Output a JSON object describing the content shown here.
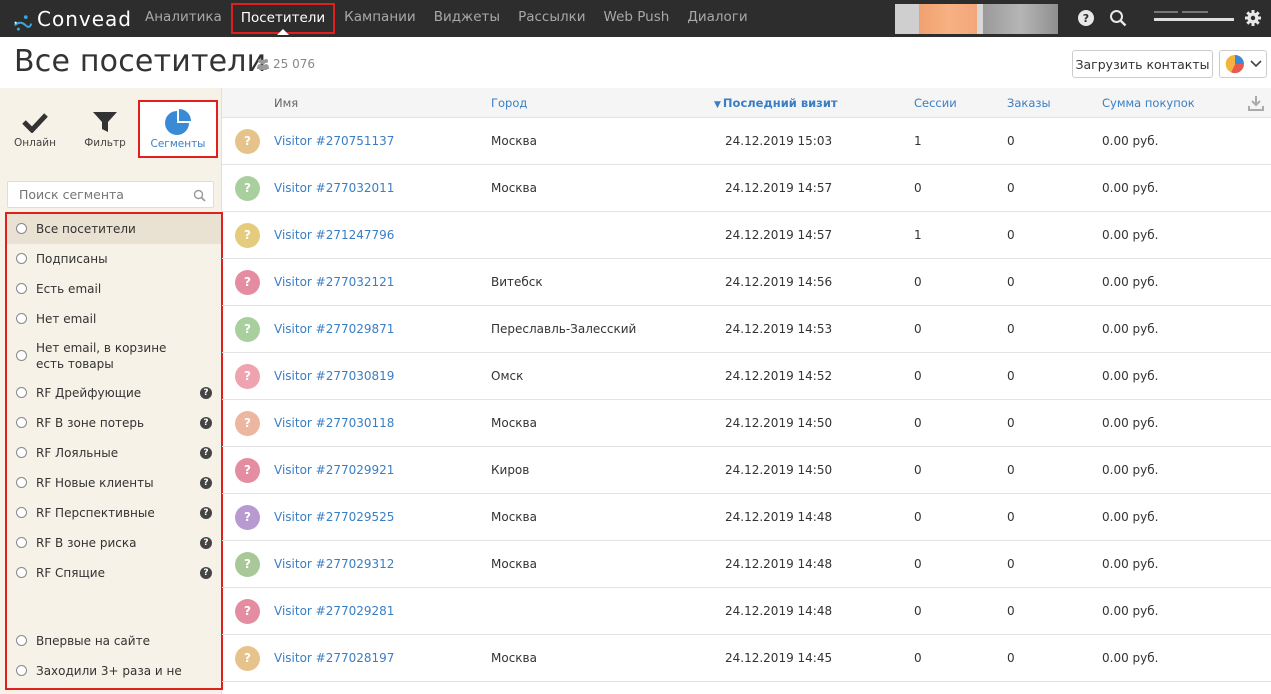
{
  "app": {
    "logo_text": "Convead",
    "nav": [
      {
        "label": "Аналитика",
        "active": false
      },
      {
        "label": "Посетители",
        "active": true
      },
      {
        "label": "Кампании",
        "active": false
      },
      {
        "label": "Виджеты",
        "active": false
      },
      {
        "label": "Рассылки",
        "active": false
      },
      {
        "label": "Web Push",
        "active": false
      },
      {
        "label": "Диалоги",
        "active": false
      }
    ],
    "icons": [
      "help-icon",
      "search-icon",
      "gear-icon"
    ]
  },
  "page": {
    "title": "Все посетители",
    "count": "25 076",
    "upload_button": "Загрузить контакты"
  },
  "sidebar": {
    "modes": [
      {
        "label": "Онлайн",
        "icon": "check-icon"
      },
      {
        "label": "Фильтр",
        "icon": "filter-icon"
      },
      {
        "label": "Сегменты",
        "icon": "pie-chart-icon",
        "active": true
      }
    ],
    "search_placeholder": "Поиск сегмента",
    "segments": [
      {
        "label": "Все посетители",
        "help": false,
        "selected": true
      },
      {
        "label": "Подписаны",
        "help": false
      },
      {
        "label": "Есть email",
        "help": false
      },
      {
        "label": "Нет email",
        "help": false
      },
      {
        "label": "Нет email, в корзине есть товары",
        "help": false
      },
      {
        "label": "RF Дрейфующие",
        "help": true
      },
      {
        "label": "RF В зоне потерь",
        "help": true
      },
      {
        "label": "RF Лояльные",
        "help": true
      },
      {
        "label": "RF Новые клиенты",
        "help": true
      },
      {
        "label": "RF Перспективные",
        "help": true
      },
      {
        "label": "RF В зоне риска",
        "help": true
      },
      {
        "label": "RF Спящие",
        "help": true
      },
      {
        "label": "",
        "spacer": true
      },
      {
        "label": "Впервые на сайте",
        "help": false
      },
      {
        "label": "Заходили 3+ раза и не",
        "help": false
      }
    ]
  },
  "table": {
    "columns": {
      "name": "Имя",
      "city": "Город",
      "last_visit": "Последний визит",
      "sessions": "Сессии",
      "orders": "Заказы",
      "sum": "Сумма покупок"
    },
    "rows": [
      {
        "name": "Visitor #270751137",
        "city": "Москва",
        "visit": "24.12.2019 15:03",
        "sessions": "1",
        "orders": "0",
        "sum": "0.00 руб.",
        "color": "#e7c38c"
      },
      {
        "name": "Visitor #277032011",
        "city": "Москва",
        "visit": "24.12.2019 14:57",
        "sessions": "0",
        "orders": "0",
        "sum": "0.00 руб.",
        "color": "#a9cf9f"
      },
      {
        "name": "Visitor #271247796",
        "city": "",
        "visit": "24.12.2019 14:57",
        "sessions": "1",
        "orders": "0",
        "sum": "0.00 руб.",
        "color": "#e4cb7e"
      },
      {
        "name": "Visitor #277032121",
        "city": "Витебск",
        "visit": "24.12.2019 14:56",
        "sessions": "0",
        "orders": "0",
        "sum": "0.00 руб.",
        "color": "#e58da0"
      },
      {
        "name": "Visitor #277029871",
        "city": "Переславль-Залесский",
        "visit": "24.12.2019 14:53",
        "sessions": "0",
        "orders": "0",
        "sum": "0.00 руб.",
        "color": "#a9cf9f"
      },
      {
        "name": "Visitor #277030819",
        "city": "Омск",
        "visit": "24.12.2019 14:52",
        "sessions": "0",
        "orders": "0",
        "sum": "0.00 руб.",
        "color": "#efa3ae"
      },
      {
        "name": "Visitor #277030118",
        "city": "Москва",
        "visit": "24.12.2019 14:50",
        "sessions": "0",
        "orders": "0",
        "sum": "0.00 руб.",
        "color": "#ecb6a0"
      },
      {
        "name": "Visitor #277029921",
        "city": "Киров",
        "visit": "24.12.2019 14:50",
        "sessions": "0",
        "orders": "0",
        "sum": "0.00 руб.",
        "color": "#e58da0"
      },
      {
        "name": "Visitor #277029525",
        "city": "Москва",
        "visit": "24.12.2019 14:48",
        "sessions": "0",
        "orders": "0",
        "sum": "0.00 руб.",
        "color": "#b89ad1"
      },
      {
        "name": "Visitor #277029312",
        "city": "Москва",
        "visit": "24.12.2019 14:48",
        "sessions": "0",
        "orders": "0",
        "sum": "0.00 руб.",
        "color": "#a9c89a"
      },
      {
        "name": "Visitor #277029281",
        "city": "",
        "visit": "24.12.2019 14:48",
        "sessions": "0",
        "orders": "0",
        "sum": "0.00 руб.",
        "color": "#e58da0"
      },
      {
        "name": "Visitor #277028197",
        "city": "Москва",
        "visit": "24.12.2019 14:45",
        "sessions": "0",
        "orders": "0",
        "sum": "0.00 руб.",
        "color": "#e7c38c"
      }
    ]
  }
}
